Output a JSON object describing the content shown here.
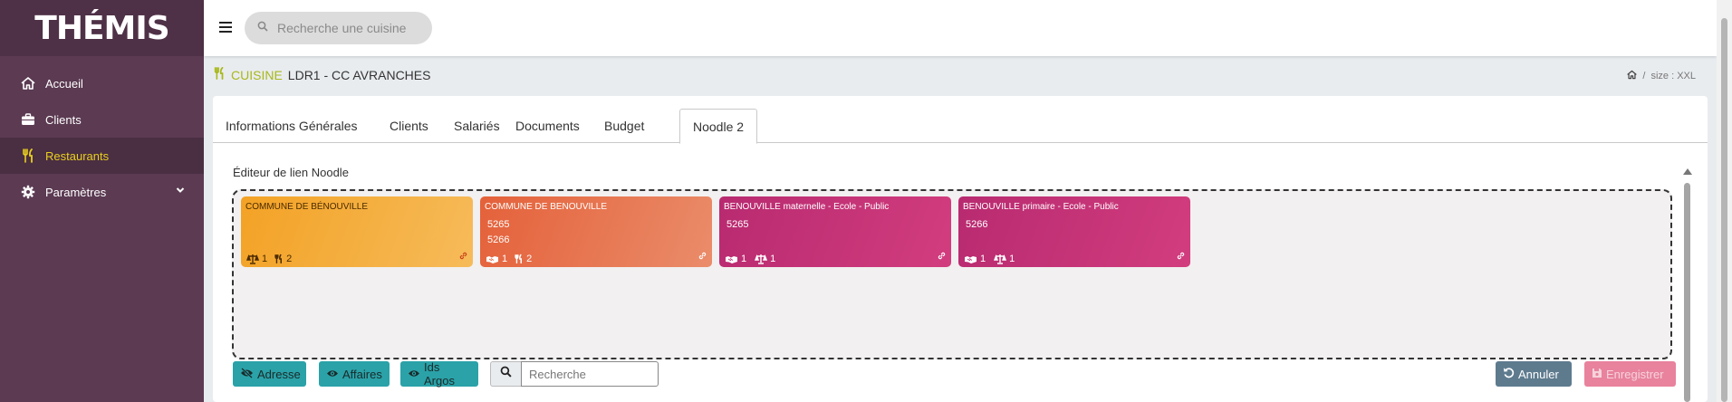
{
  "app": {
    "logo": "THÉMIS"
  },
  "sidebar": {
    "items": [
      {
        "label": "Accueil",
        "icon": "home-icon"
      },
      {
        "label": "Clients",
        "icon": "briefcase-icon"
      },
      {
        "label": "Restaurants",
        "icon": "utensils-icon"
      },
      {
        "label": "Paramètres",
        "icon": "gear-icon"
      }
    ]
  },
  "topbar": {
    "search_placeholder": "Recherche une cuisine"
  },
  "header": {
    "label": "CUISINE",
    "title": "LDR1 - CC AVRANCHES",
    "breadcrumb_size": "size : XXL"
  },
  "tabs": [
    {
      "label": "Informations Générales"
    },
    {
      "label": "Clients"
    },
    {
      "label": "Salariés"
    },
    {
      "label": "Documents"
    },
    {
      "label": "Budget"
    },
    {
      "label": "Noodle 2"
    }
  ],
  "editor": {
    "title": "Éditeur de lien Noodle"
  },
  "nodes": [
    {
      "name": "COMMUNE DE BÉNOUVILLE",
      "ids": [],
      "foot": {
        "a_icon": "balance-icon",
        "a": "1",
        "b_icon": "utensils-icon",
        "b": "2"
      }
    },
    {
      "name": "COMMUNE DE BENOUVILLE",
      "ids": [
        "5265",
        "5266"
      ],
      "foot": {
        "a_icon": "handshake-icon",
        "a": "1",
        "b_icon": "utensils-icon",
        "b": "2"
      }
    },
    {
      "name": "BENOUVILLE maternelle - Ecole - Public",
      "ids": [
        "5265"
      ],
      "foot": {
        "a_icon": "handshake-icon",
        "a": "1",
        "b_icon": "balance-icon",
        "b": "1"
      }
    },
    {
      "name": "BENOUVILLE primaire - Ecole - Public",
      "ids": [
        "5266"
      ],
      "foot": {
        "a_icon": "handshake-icon",
        "a": "1",
        "b_icon": "balance-icon",
        "b": "1"
      }
    }
  ],
  "toolbar": {
    "adresse": "Adresse",
    "affaires": "Affaires",
    "ids_argos": "Ids Argos",
    "search_placeholder": "Recherche",
    "annuler": "Annuler",
    "enregistrer": "Enregistrer"
  },
  "colors": {
    "sidebar": "#5b3a52",
    "active_nav": "#e8cf1f",
    "accent": "#a8b81a",
    "teal": "#2aa2a8",
    "node_commune": "#f3a225",
    "node_commune2": "#e4613a",
    "node_ecole": "#b82a70"
  }
}
